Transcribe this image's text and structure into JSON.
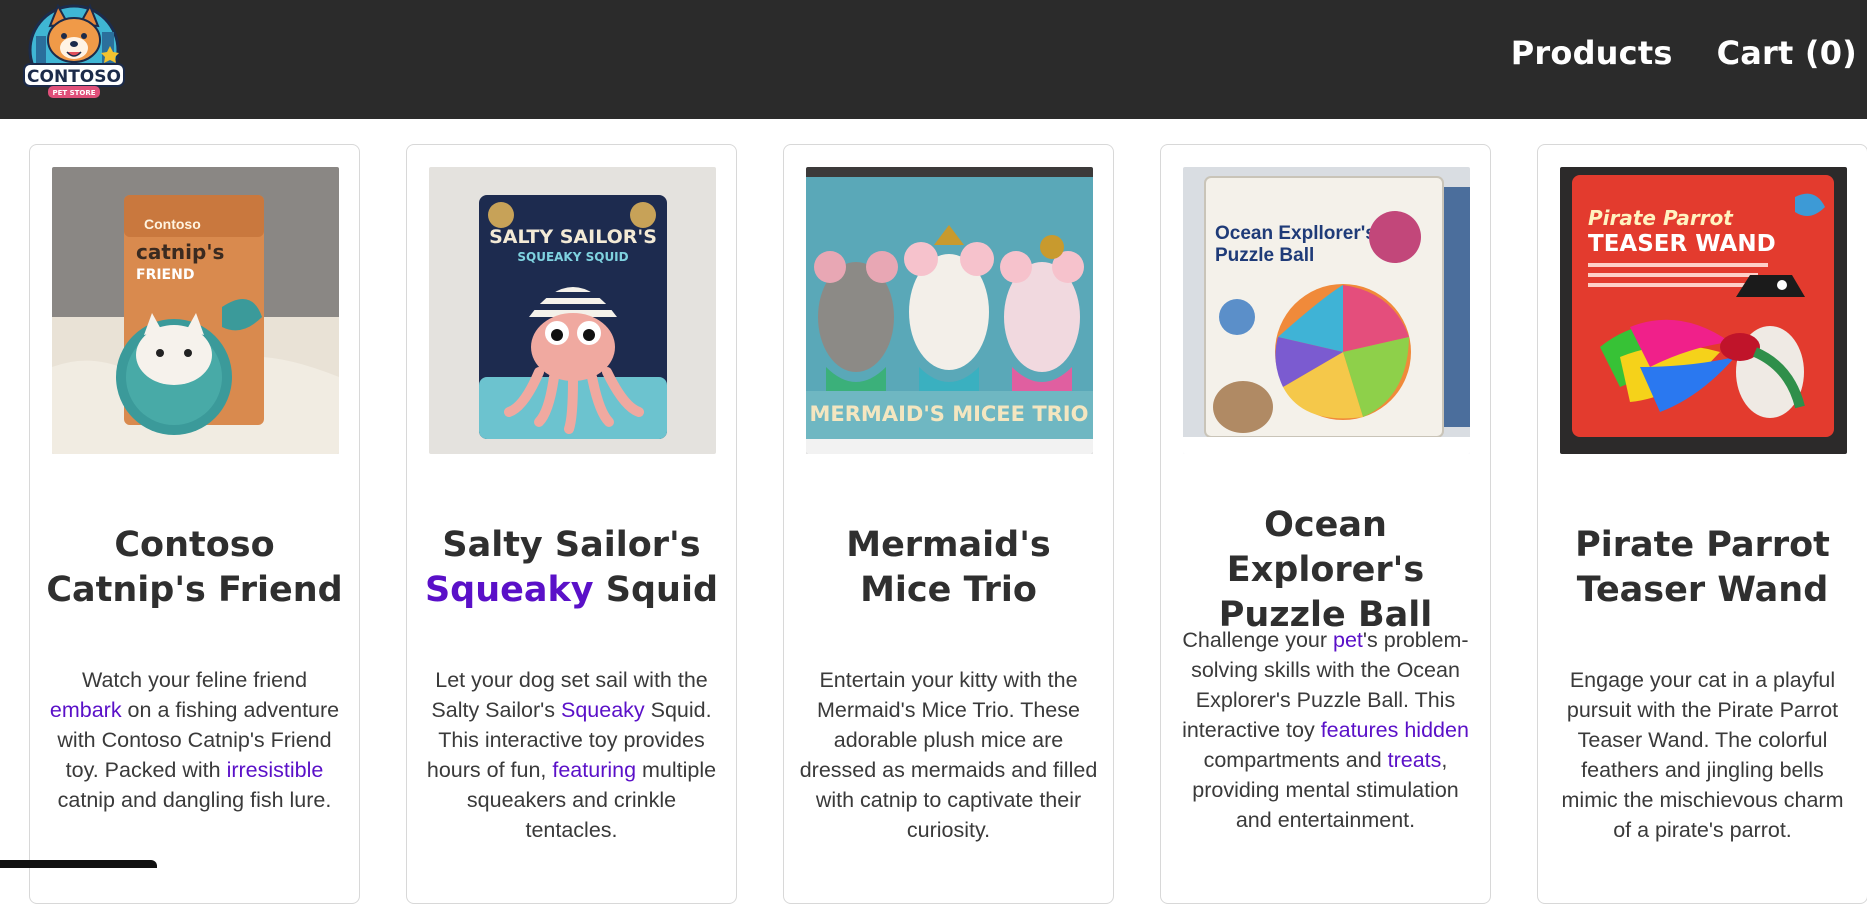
{
  "header": {
    "logo_text": "CONTOSO",
    "logo_subtext": "PET STORE",
    "nav": [
      {
        "label": "Products"
      },
      {
        "label": "Cart (0)"
      }
    ]
  },
  "products": [
    {
      "title_parts": [
        "Contoso Catnip's Friend"
      ],
      "desc": [
        "Watch your feline friend ",
        "embark",
        " on a fishing adventure with Contoso Catnip's Friend toy. Packed with ",
        "irresistible",
        " catnip and dangling fish lure."
      ],
      "package_text": [
        "Contoso",
        "catnip's",
        "FRIEND"
      ]
    },
    {
      "title_parts": [
        "Salty Sailor's ",
        "Squeaky",
        " Squid"
      ],
      "desc": [
        "Let your dog set sail with the Salty Sailor's ",
        "Squeaky",
        " Squid. This interactive toy provides hours of fun, ",
        "featuring",
        " multiple squeakers and crinkle tentacles."
      ],
      "package_text": [
        "SALTY SAILOR'S",
        "SQUEAKY SQUID"
      ]
    },
    {
      "title_parts": [
        "Mermaid's Mice Trio"
      ],
      "desc": [
        "Entertain your kitty with the Mermaid's Mice Trio. These adorable plush mice are dressed as mermaids and filled with catnip to captivate their curiosity."
      ],
      "package_text": [
        "MERMAID'S MICEE TRIO"
      ]
    },
    {
      "title_parts": [
        "Ocean Explorer's Puzzle Ball"
      ],
      "desc": [
        "Challenge your ",
        "pet",
        "'s problem-solving skills with the Ocean Explorer's Puzzle Ball. This interactive toy ",
        "features hidden",
        " compartments and ",
        "treats",
        ", providing mental stimulation and entertainment."
      ],
      "package_text": [
        "Ocean Expllorer's",
        "Puzzle Ball"
      ]
    },
    {
      "title_parts": [
        "Pirate Parrot Teaser Wand"
      ],
      "desc": [
        "Engage your cat in a playful pursuit with the Pirate Parrot Teaser Wand. The colorful feathers and jingling bells mimic the mischievous charm of a pirate's parrot."
      ],
      "package_text": [
        "Pirate Parrot",
        "TEASER WAND"
      ]
    }
  ],
  "colors": {
    "header_bg": "#2b2b2b",
    "highlight": "#5a10c8"
  }
}
